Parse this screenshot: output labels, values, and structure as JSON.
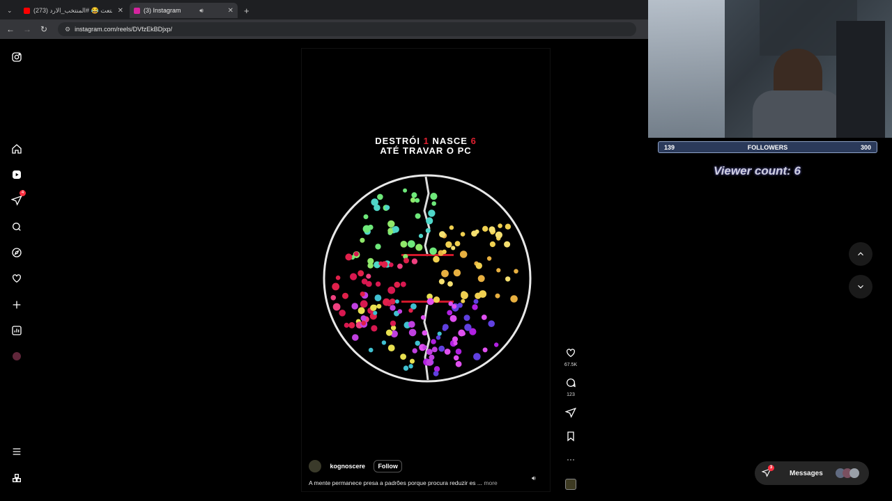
{
  "browser": {
    "tabs": [
      {
        "title": "(273) ابتعت 😂 #المنتخب_الارد...",
        "favicon_color": "#ff0000"
      },
      {
        "title": "(3) Instagram",
        "favicon_color": "#d6249f"
      }
    ],
    "new_tab": "+",
    "url": "instagram.com/reels/DVfzEkBDjxp/"
  },
  "sidebar": {
    "notifications_badge": "4"
  },
  "reel": {
    "title_parts": [
      "DESTRÓI ",
      "1",
      " NASCE ",
      "6"
    ],
    "title_line2": "ATÉ TRAVAR O PC",
    "accent_color": "#e02030",
    "username": "kognoscere",
    "follow_label": "Follow",
    "caption": "A mente permanece presa a padrões porque procura reduzir es ...",
    "more_label": "more"
  },
  "actions": {
    "likes": "67.5K",
    "comments": "123"
  },
  "messages": {
    "label": "Messages",
    "badge": "3"
  },
  "overlay": {
    "followers_current": "139",
    "followers_label": "FOLLOWERS",
    "followers_goal": "300",
    "viewer_count": "Viewer count: 6"
  }
}
